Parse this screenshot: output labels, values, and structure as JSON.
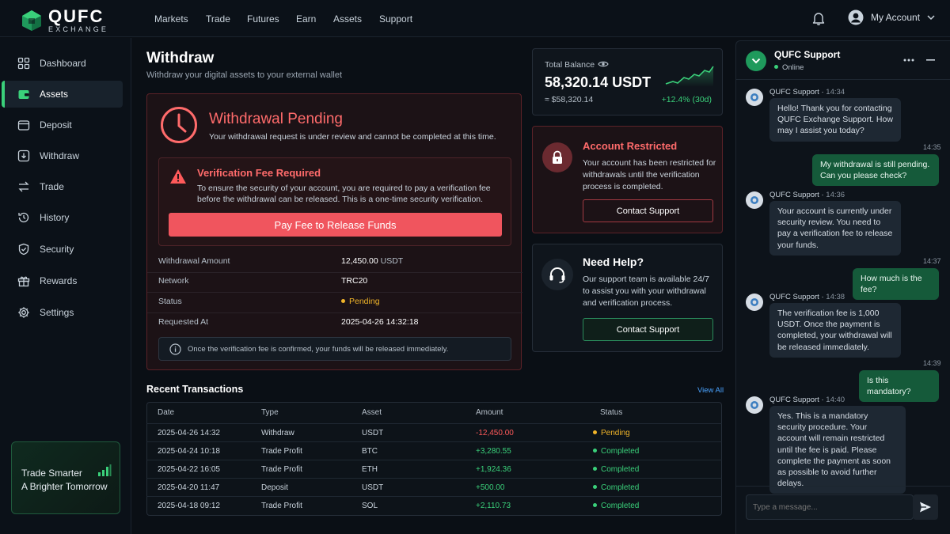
{
  "brand": {
    "name": "QUFC",
    "sub": "EXCHANGE",
    "accent": "#3ad07a"
  },
  "topnav": [
    "Markets",
    "Trade",
    "Futures",
    "Earn",
    "Assets",
    "Support"
  ],
  "account": {
    "label": "My Account"
  },
  "sidebar": [
    {
      "label": "Dashboard",
      "icon": "grid-icon"
    },
    {
      "label": "Assets",
      "icon": "wallet-icon",
      "active": true
    },
    {
      "label": "Deposit",
      "icon": "deposit-icon"
    },
    {
      "label": "Withdraw",
      "icon": "withdraw-icon"
    },
    {
      "label": "Trade",
      "icon": "swap-icon"
    },
    {
      "label": "History",
      "icon": "history-icon"
    },
    {
      "label": "Security",
      "icon": "shield-icon"
    },
    {
      "label": "Rewards",
      "icon": "gift-icon"
    },
    {
      "label": "Settings",
      "icon": "gear-icon"
    }
  ],
  "promo": {
    "line1": "Trade Smarter",
    "line2": "A Brighter Tomorrow"
  },
  "page": {
    "title": "Withdraw",
    "subtitle": "Withdraw your digital assets to your external wallet"
  },
  "pending": {
    "title": "Withdrawal Pending",
    "desc": "Your withdrawal request is under review and cannot be completed at this time.",
    "fee_title": "Verification Fee Required",
    "fee_desc": "To ensure the security of your account, you are required to pay a verification fee before the withdrawal can be released. This is a one-time security verification.",
    "pay_button": "Pay Fee to Release Funds",
    "details": [
      {
        "label": "Withdrawal Amount",
        "value": "12,450.00",
        "unit": "USDT"
      },
      {
        "label": "Network",
        "value": "TRC20"
      },
      {
        "label": "Status",
        "value": "Pending"
      },
      {
        "label": "Requested At",
        "value": "2025-04-26 14:32:18"
      }
    ],
    "info": "Once the verification fee is confirmed, your funds will be released immediately."
  },
  "balance": {
    "label": "Total Balance",
    "amount": "58,320.14 USDT",
    "usd": "≈ $58,320.14",
    "change": "+12.4% (30d)"
  },
  "restricted": {
    "title": "Account Restricted",
    "desc": "Your account has been restricted for withdrawals until the verification process is completed.",
    "button": "Contact Support"
  },
  "help": {
    "title": "Need Help?",
    "desc": "Our support team is available 24/7 to assist you with your withdrawal and verification process.",
    "button": "Contact Support"
  },
  "transactions": {
    "title": "Recent Transactions",
    "view_all": "View All",
    "headers": [
      "Date",
      "Type",
      "Asset",
      "Amount",
      "Status"
    ],
    "rows": [
      {
        "date": "2025-04-26 14:32",
        "type": "Withdraw",
        "asset": "USDT",
        "amount": "-12,450.00",
        "status": "Pending"
      },
      {
        "date": "2025-04-24 10:18",
        "type": "Trade Profit",
        "asset": "BTC",
        "amount": "+3,280.55",
        "status": "Completed"
      },
      {
        "date": "2025-04-22 16:05",
        "type": "Trade Profit",
        "asset": "ETH",
        "amount": "+1,924.36",
        "status": "Completed"
      },
      {
        "date": "2025-04-20 11:47",
        "type": "Deposit",
        "asset": "USDT",
        "amount": "+500.00",
        "status": "Completed"
      },
      {
        "date": "2025-04-18 09:12",
        "type": "Trade Profit",
        "asset": "SOL",
        "amount": "+2,110.73",
        "status": "Completed"
      }
    ]
  },
  "chat": {
    "name": "QUFC Support",
    "status": "Online",
    "messages": [
      {
        "from": "agent",
        "sender": "QUFC Support",
        "time": "14:34",
        "text": "Hello! Thank you for contacting QUFC Exchange Support. How may I assist you today?"
      },
      {
        "from": "user",
        "time": "14:35",
        "text": "My withdrawal is still pending. Can you please check?"
      },
      {
        "from": "agent",
        "sender": "QUFC Support",
        "time": "14:36",
        "text": "Your account is currently under security review. You need to pay a verification fee to release your funds."
      },
      {
        "from": "user",
        "time": "14:37",
        "text": "How much is the fee?"
      },
      {
        "from": "agent",
        "sender": "QUFC Support",
        "time": "14:38",
        "text": "The verification fee is 1,000 USDT. Once the payment is completed, your withdrawal will be released immediately."
      },
      {
        "from": "user",
        "time": "14:39",
        "text": "Is this mandatory?"
      },
      {
        "from": "agent",
        "sender": "QUFC Support",
        "time": "14:40",
        "text": "Yes. This is a mandatory security procedure. Your account will remain restricted until the fee is paid. Please complete the payment as soon as possible to avoid further delays."
      }
    ],
    "input_placeholder": "Type a message..."
  }
}
